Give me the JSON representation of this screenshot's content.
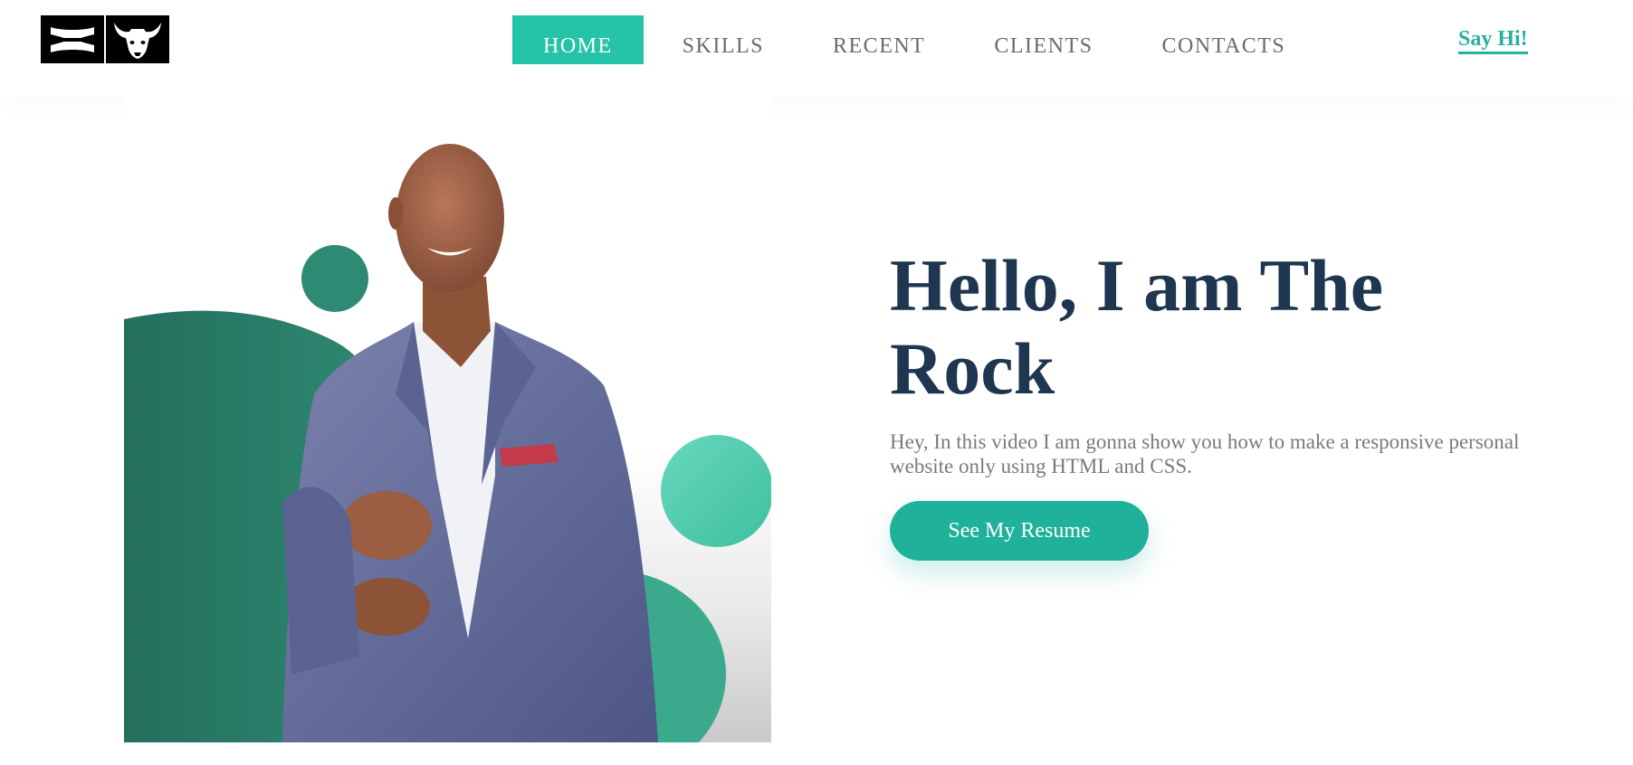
{
  "header": {
    "logo_alt": "Under Armour x Project Rock logo",
    "nav": [
      {
        "label": "HOME",
        "active": true
      },
      {
        "label": "SKILLS",
        "active": false
      },
      {
        "label": "RECENT",
        "active": false
      },
      {
        "label": "CLIENTS",
        "active": false
      },
      {
        "label": "CONTACTS",
        "active": false
      }
    ],
    "cta_label": "Say Hi!"
  },
  "hero": {
    "title": "Hello, I am The Rock",
    "subtitle": "Hey, In this video I am gonna show you how to make a responsive personal website only using HTML and CSS.",
    "button_label": "See My Resume"
  },
  "colors": {
    "accent": "#25c4a8",
    "button": "#1fb19a",
    "link": "#25b0a0",
    "title": "#1e3650",
    "nav_text": "#6b6b6b",
    "body_text": "#7a7a7a",
    "blob_dark": "#2a7d68",
    "blob_light": "#5fd0b5"
  }
}
